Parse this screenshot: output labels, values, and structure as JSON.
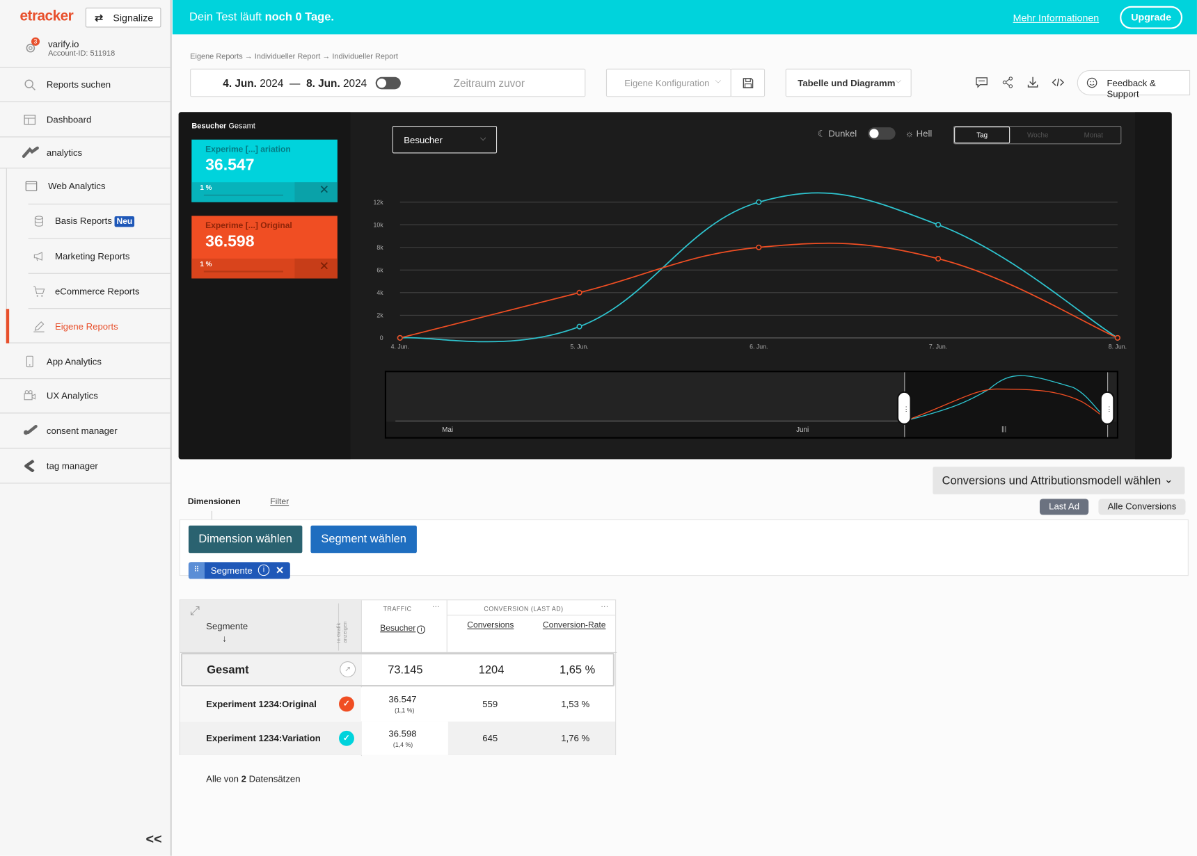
{
  "sidebar": {
    "logo": "etracker",
    "signalize_label": "Signalize",
    "account": {
      "name": "varify.io",
      "id": "Account-ID: 511918",
      "notification_count": "3"
    },
    "search_label": "Reports suchen",
    "dashboard_label": "Dashboard",
    "analytics_label": "analytics",
    "web_analytics_label": "Web Analytics",
    "basis_reports_label": "Basis Reports",
    "neu_badge": "Neu",
    "marketing_reports_label": "Marketing Reports",
    "ecommerce_reports_label": "eCommerce Reports",
    "eigene_reports_label": "Eigene Reports",
    "app_analytics_label": "App Analytics",
    "ux_analytics_label": "UX Analytics",
    "consent_manager_label": "consent manager",
    "tag_manager_label": "tag manager",
    "collapse_label": "<<"
  },
  "banner": {
    "text_prefix": "Dein Test läuft ",
    "text_bold": "noch 0 Tage.",
    "more_info": "Mehr Informationen",
    "upgrade": "Upgrade",
    "color": "#00d3dc"
  },
  "breadcrumb": "Eigene Reports → Individueller Report → Individueller Report",
  "toolbar": {
    "date_start_day": "4. Jun.",
    "date_start_year": "2024",
    "date_sep": "—",
    "date_end_day": "8. Jun.",
    "date_end_year": "2024",
    "compare_label": "Zeitraum zuvor",
    "config_placeholder": "Eigene Konfiguration",
    "view_select": "Tabelle und Diagramm",
    "feedback_label": "Feedback & Support"
  },
  "chart_panel": {
    "header_bold": "Besucher",
    "header_rest": "Gesamt",
    "metric_select": "Besucher",
    "dark_label": "Dunkel",
    "light_label": "Hell",
    "period_tabs": [
      "Tag",
      "Woche",
      "Monat"
    ],
    "cards": [
      {
        "title": "Experime [...] ariation",
        "value": "36.547",
        "pct": "1 %",
        "color": "#00d3dc"
      },
      {
        "title": "Experime [...] Original",
        "value": "36.598",
        "pct": "1 %",
        "color": "#f04e23"
      }
    ],
    "navigator_labels": [
      "Mai",
      "Juni"
    ]
  },
  "chart_data": {
    "type": "line",
    "x": [
      "4. Jun.",
      "5. Jun.",
      "6. Jun.",
      "7. Jun.",
      "8. Jun."
    ],
    "y_ticks": [
      "0",
      "2k",
      "4k",
      "6k",
      "8k",
      "10k",
      "12k"
    ],
    "ylim": [
      0,
      12000
    ],
    "grid": true,
    "series": [
      {
        "color": "#2ec4cf",
        "values": [
          0,
          1000,
          12000,
          10000,
          0
        ]
      },
      {
        "color": "#f04e23",
        "values": [
          0,
          4000,
          8000,
          7000,
          0
        ]
      }
    ]
  },
  "attribution": {
    "select_label": "Conversions und Attributionsmodell wählen",
    "last_ad": "Last Ad",
    "all_conversions": "Alle Conversions"
  },
  "tabs": {
    "dimensionen": "Dimensionen",
    "filter": "Filter"
  },
  "dimension_buttons": {
    "dimension": "Dimension wählen",
    "segment": "Segment wählen"
  },
  "segment_chip": {
    "label": "Segmente"
  },
  "table": {
    "group_traffic": "TRAFFIC",
    "group_conversion": "CONVERSION (LAST AD)",
    "segment_header": "Segmente",
    "chart_toggle_header": "In Grafik anzeigen",
    "columns": [
      "Besucher",
      "Conversions",
      "Conversion-Rate"
    ],
    "total": {
      "label": "Gesamt",
      "besucher": "73.145",
      "conversions": "1204",
      "rate": "1,65 %"
    },
    "rows": [
      {
        "label": "Experiment 1234:Original",
        "besucher": "36.547",
        "besucher_share": "(1,1 %)",
        "conversions": "559",
        "rate": "1,53 %",
        "color": "#f04e23"
      },
      {
        "label": "Experiment 1234:Variation",
        "besucher": "36.598",
        "besucher_share": "(1,4 %)",
        "conversions": "645",
        "rate": "1,76 %",
        "color": "#00d3dc"
      }
    ],
    "footer_prefix": "Alle von ",
    "footer_count": "2",
    "footer_suffix": " Datensätzen"
  }
}
